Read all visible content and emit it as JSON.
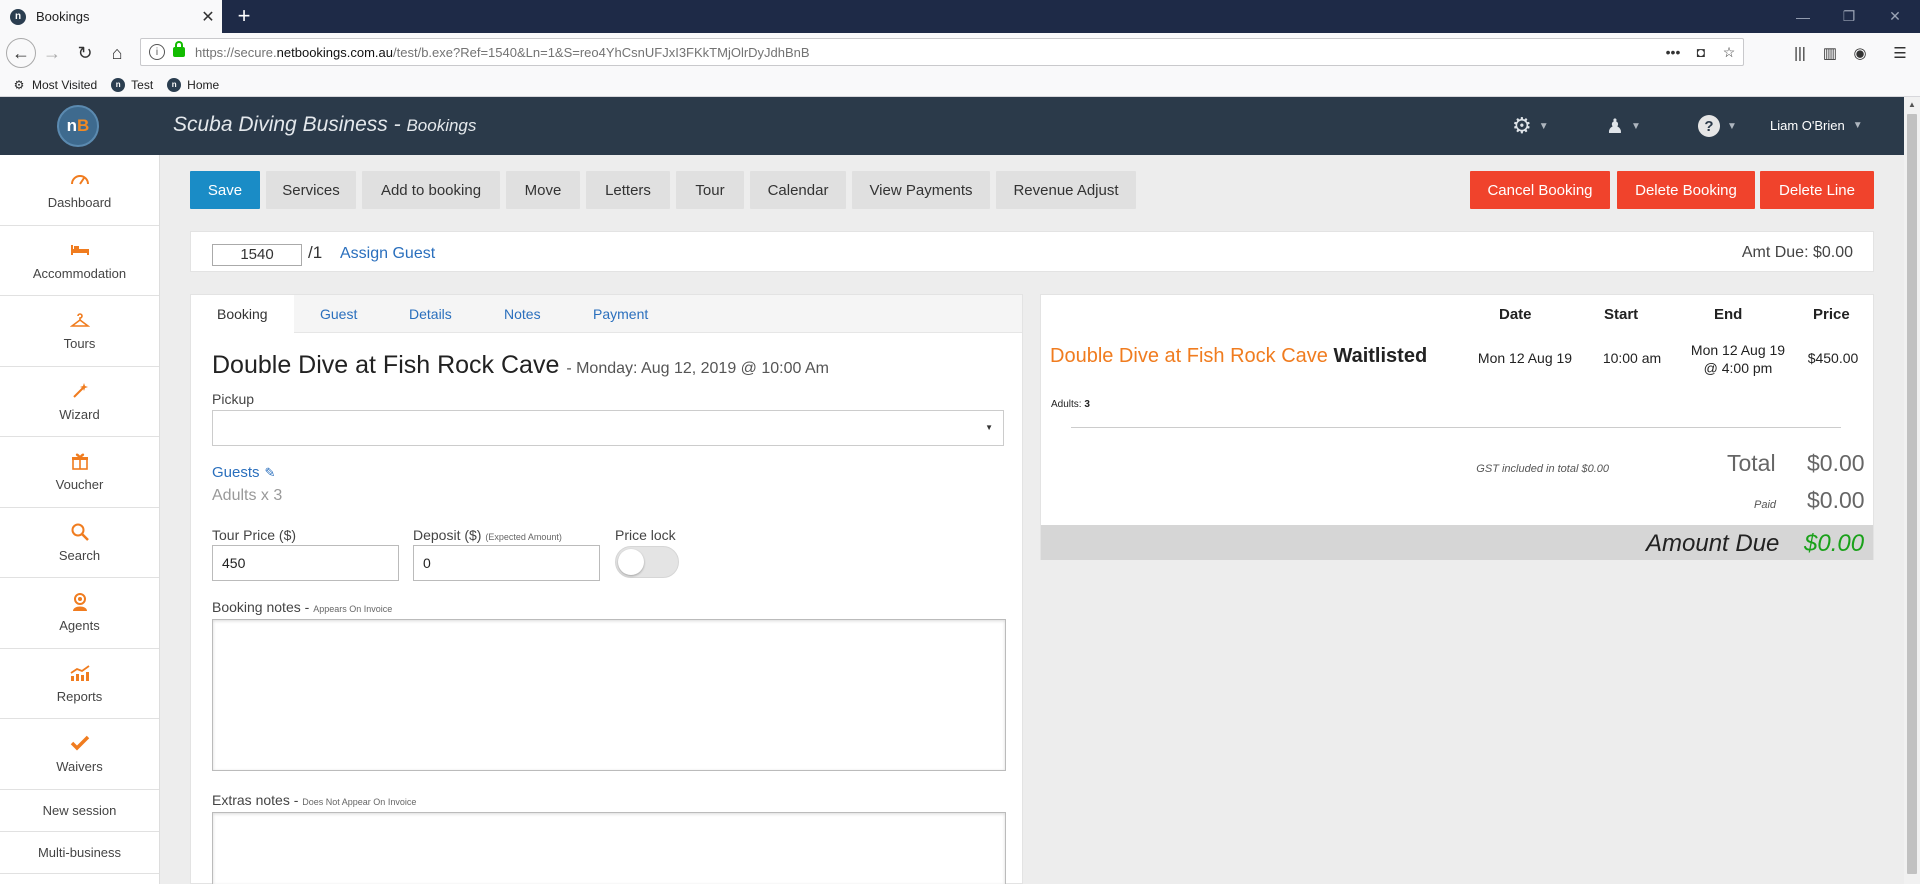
{
  "browser": {
    "tab_title": "Bookings",
    "tab_favicon": "n",
    "url_prefix": "https://secure.",
    "url_domain": "netbookings.com.au",
    "url_rest": "/test/b.exe?Ref=1540&Ln=1&S=reo4YhCsnUFJxI3FKkTMjOlrDyJdhBnB",
    "bookmarks": [
      {
        "label": "Most Visited"
      },
      {
        "label": "Test"
      },
      {
        "label": "Home"
      }
    ]
  },
  "header": {
    "logo_text_n": "n",
    "logo_text_b": "B",
    "business": "Scuba Diving Business",
    "separator": " - ",
    "section": "Bookings",
    "user": "Liam O'Brien"
  },
  "sidebar": {
    "items": [
      {
        "label": "Dashboard",
        "icon": "dashboard-gauge-icon"
      },
      {
        "label": "Accommodation",
        "icon": "bed-icon"
      },
      {
        "label": "Tours",
        "icon": "hanger-icon"
      },
      {
        "label": "Wizard",
        "icon": "magic-wand-icon"
      },
      {
        "label": "Voucher",
        "icon": "gift-icon"
      },
      {
        "label": "Search",
        "icon": "search-icon"
      },
      {
        "label": "Agents",
        "icon": "agent-icon"
      },
      {
        "label": "Reports",
        "icon": "chart-up-icon"
      },
      {
        "label": "Waivers",
        "icon": "check-icon"
      }
    ],
    "new_session": "New session",
    "multi_business": "Multi-business"
  },
  "actions": {
    "save": "Save",
    "services": "Services",
    "add_to_booking": "Add to booking",
    "move": "Move",
    "letters": "Letters",
    "tour": "Tour",
    "calendar": "Calendar",
    "view_payments": "View Payments",
    "revenue_adjust": "Revenue Adjust",
    "cancel_booking": "Cancel Booking",
    "delete_booking": "Delete Booking",
    "delete_line": "Delete Line"
  },
  "booking_ref": {
    "number": "1540",
    "line": "/1",
    "assign_guest": "Assign Guest",
    "amt_due": "Amt Due: $0.00"
  },
  "tabs": [
    "Booking",
    "Guest",
    "Details",
    "Notes",
    "Payment"
  ],
  "form": {
    "title": "Double Dive at Fish Rock Cave",
    "date_text": "- Monday: Aug 12, 2019 @ 10:00 Am",
    "pickup_label": "Pickup",
    "pickup_value": "",
    "guests_label": "Guests",
    "guests_value": "Adults x 3",
    "tour_price_label": "Tour Price ($)",
    "tour_price_value": "450",
    "deposit_label": "Deposit ($)",
    "deposit_hint": "(Expected Amount)",
    "deposit_value": "0",
    "price_lock_label": "Price lock",
    "price_lock_on": false,
    "booking_notes_label": "Booking notes -",
    "booking_notes_hint": "Appears On Invoice",
    "extras_notes_label": "Extras notes -",
    "extras_notes_hint": "Does Not Appear On Invoice"
  },
  "summary": {
    "col_date": "Date",
    "col_start": "Start",
    "col_end": "End",
    "col_price": "Price",
    "service": "Double Dive at Fish Rock Cave",
    "status": "Waitlisted",
    "date": "Mon 12 Aug 19",
    "start": "10:00 am",
    "end_line1": "Mon 12 Aug 19",
    "end_line2": "@ 4:00 pm",
    "price": "$450.00",
    "adults_label": "Adults:",
    "adults_value": "3",
    "gst_text": "GST included in total $0.00",
    "total_label": "Total",
    "total_value": "$0.00",
    "paid_label": "Paid",
    "paid_value": "$0.00",
    "amount_due_label": "Amount Due",
    "amount_due_value": "$0.00"
  },
  "colors": {
    "header_bg": "#2b3a4a",
    "primary": "#1a8cc6",
    "danger": "#f0432c",
    "accent_orange": "#f07c1f",
    "link": "#2a6fbd",
    "amount_green": "#1aa11a"
  }
}
